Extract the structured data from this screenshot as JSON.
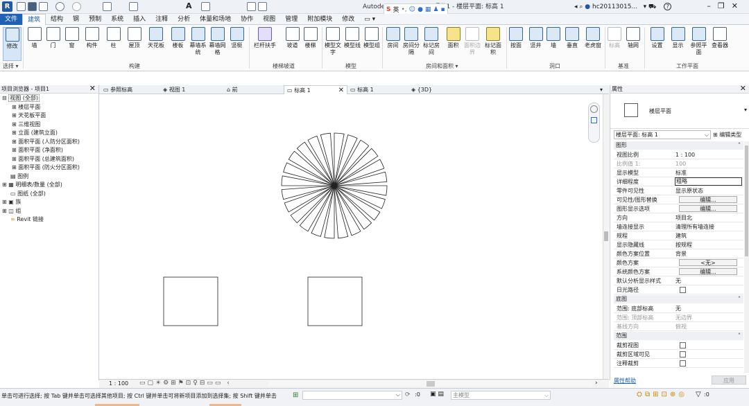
{
  "title_bar": {
    "app_title": "Autodesk Revit 2022 - 项目1 - 楼层平面: 标高 1",
    "ime_label": "英",
    "user_name": "hc20113015...",
    "help_label": "?"
  },
  "ribbon_tabs": [
    "文件",
    "建筑",
    "结构",
    "钢",
    "预制",
    "系统",
    "插入",
    "注释",
    "分析",
    "体量和场地",
    "协作",
    "视图",
    "管理",
    "附加模块",
    "修改"
  ],
  "ribbon": {
    "buttons": [
      {
        "label": "修改",
        "icon": "cursor-icon"
      },
      {
        "label": "墙",
        "icon": "wall-icon"
      },
      {
        "label": "门",
        "icon": "door-icon"
      },
      {
        "label": "窗",
        "icon": "window-icon"
      },
      {
        "label": "构件",
        "icon": "component-icon"
      },
      {
        "label": "柱",
        "icon": "column-icon"
      },
      {
        "label": "屋顶",
        "icon": "roof-icon"
      },
      {
        "label": "天花板",
        "icon": "ceiling-icon"
      },
      {
        "label": "楼板",
        "icon": "floor-icon"
      },
      {
        "label": "幕墙系统",
        "icon": "curtain-system-icon"
      },
      {
        "label": "幕墙网格",
        "icon": "curtain-grid-icon"
      },
      {
        "label": "竖梃",
        "icon": "mullion-icon"
      },
      {
        "label": "栏杆扶手",
        "icon": "railing-icon"
      },
      {
        "label": "坡道",
        "icon": "ramp-icon"
      },
      {
        "label": "楼梯",
        "icon": "stair-icon"
      },
      {
        "label": "模型文字",
        "icon": "model-text-icon"
      },
      {
        "label": "模型线",
        "icon": "model-line-icon"
      },
      {
        "label": "模型组",
        "icon": "model-group-icon"
      },
      {
        "label": "房间",
        "icon": "room-icon"
      },
      {
        "label": "房间分隔",
        "icon": "room-separator-icon"
      },
      {
        "label": "标记房间",
        "icon": "tag-room-icon"
      },
      {
        "label": "面积",
        "icon": "area-icon"
      },
      {
        "label": "面积边界",
        "icon": "area-boundary-icon"
      },
      {
        "label": "标记面积",
        "icon": "tag-area-icon"
      },
      {
        "label": "按面",
        "icon": "by-face-icon"
      },
      {
        "label": "竖井",
        "icon": "shaft-icon"
      },
      {
        "label": "墙",
        "icon": "wall-opening-icon"
      },
      {
        "label": "垂直",
        "icon": "vertical-icon"
      },
      {
        "label": "老虎窗",
        "icon": "dormer-icon"
      },
      {
        "label": "标高",
        "icon": "level-icon"
      },
      {
        "label": "轴网",
        "icon": "grid-icon"
      },
      {
        "label": "设置",
        "icon": "set-icon"
      },
      {
        "label": "显示",
        "icon": "show-icon"
      },
      {
        "label": "参照平面",
        "icon": "ref-plane-icon"
      },
      {
        "label": "查看器",
        "icon": "viewer-icon"
      }
    ],
    "groups": [
      "选择 ▾",
      "构建",
      "楼梯坡道",
      "模型",
      "房间和面积 ▾",
      "洞口",
      "基准",
      "工作平面"
    ]
  },
  "project_browser": {
    "title": "项目浏览器 - 项目1",
    "items": [
      "视图 (全部)",
      "楼层平面",
      "天花板平面",
      "三维视图",
      "立面 (建筑立面)",
      "面积平面 (人防分区面积)",
      "面积平面 (净面积)",
      "面积平面 (总建筑面积)",
      "面积平面 (防火分区面积)",
      "图例",
      "明细表/数量 (全部)",
      "图纸 (全部)",
      "族",
      "组",
      "Revit 链接"
    ]
  },
  "view_tabs": [
    "参照标高",
    "视图 1",
    "前",
    "标高 1",
    "标高 1",
    "{3D}"
  ],
  "properties": {
    "title": "属性",
    "type_name": "楼层平面",
    "selector": "楼层平面: 标高 1",
    "edit_type": "编辑类型",
    "sections": {
      "graphics": "图形",
      "underlay": "底图",
      "extents": "范围"
    },
    "rows": [
      {
        "k": "视图比例",
        "v": "1 : 100"
      },
      {
        "k": "比例值 1:",
        "v": "100"
      },
      {
        "k": "显示模型",
        "v": "标准"
      },
      {
        "k": "详细程度",
        "v": "粗略"
      },
      {
        "k": "零件可见性",
        "v": "显示原状态"
      },
      {
        "k": "可见性/图形替换",
        "v": "编辑..."
      },
      {
        "k": "图形显示选项",
        "v": "编辑..."
      },
      {
        "k": "方向",
        "v": "项目北"
      },
      {
        "k": "墙连接显示",
        "v": "清理所有墙连接"
      },
      {
        "k": "规程",
        "v": "建筑"
      },
      {
        "k": "显示隐藏线",
        "v": "按规程"
      },
      {
        "k": "颜色方案位置",
        "v": "背景"
      },
      {
        "k": "颜色方案",
        "v": "<无>"
      },
      {
        "k": "系统颜色方案",
        "v": "编辑..."
      },
      {
        "k": "默认分析显示样式",
        "v": "无"
      },
      {
        "k": "日光路径",
        "v": ""
      },
      {
        "k": "范围: 底部标高",
        "v": "无"
      },
      {
        "k": "范围: 顶部标高",
        "v": "无边界"
      },
      {
        "k": "基线方向",
        "v": "俯视"
      },
      {
        "k": "裁剪视图",
        "v": ""
      },
      {
        "k": "裁剪区域可见",
        "v": ""
      },
      {
        "k": "注释裁剪",
        "v": ""
      }
    ],
    "help_link": "属性帮助",
    "apply": "应用"
  },
  "view_control": {
    "scale": "1 : 100"
  },
  "status": {
    "message": "单击可进行选择; 按 Tab 键并单击可选择其他项目; 按 Ctrl 键并单击可将新项目添加到选择集; 按 Shift 键并单击",
    "zero": ":0",
    "model": "主模型",
    "filter_count": ":0"
  }
}
